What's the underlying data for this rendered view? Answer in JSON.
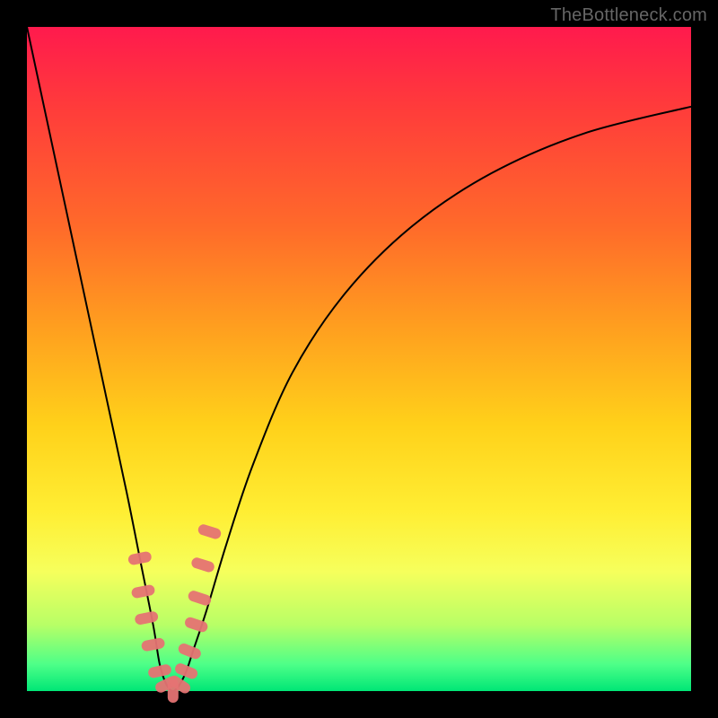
{
  "watermark": "TheBottleneck.com",
  "colors": {
    "frame": "#000000",
    "gradient_top": "#ff1a4d",
    "gradient_mid_upper": "#ff9e1f",
    "gradient_mid": "#ffee33",
    "gradient_lower": "#4dff88",
    "gradient_bottom": "#00e676",
    "curve": "#000000",
    "marker": "#e57373"
  },
  "chart_data": {
    "type": "line",
    "title": "",
    "xlabel": "",
    "ylabel": "",
    "xlim": [
      0,
      100
    ],
    "ylim": [
      0,
      100
    ],
    "x": [
      0,
      3,
      6,
      9,
      12,
      15,
      17,
      19,
      20,
      21,
      22,
      23,
      24,
      25,
      27,
      30,
      34,
      40,
      48,
      58,
      70,
      84,
      100
    ],
    "y": [
      100,
      86,
      72,
      58,
      44,
      30,
      20,
      10,
      4,
      1,
      0,
      1,
      3,
      6,
      12,
      22,
      34,
      48,
      60,
      70,
      78,
      84,
      88
    ],
    "markers": {
      "note": "salmon capsule-shaped markers clustered near the curve minimum",
      "points": [
        {
          "x": 17,
          "y": 20
        },
        {
          "x": 17.5,
          "y": 15
        },
        {
          "x": 18,
          "y": 11
        },
        {
          "x": 19,
          "y": 7
        },
        {
          "x": 20,
          "y": 3
        },
        {
          "x": 21,
          "y": 1
        },
        {
          "x": 22,
          "y": 0
        },
        {
          "x": 23,
          "y": 1
        },
        {
          "x": 24,
          "y": 3
        },
        {
          "x": 24.5,
          "y": 6
        },
        {
          "x": 25.5,
          "y": 10
        },
        {
          "x": 26,
          "y": 14
        },
        {
          "x": 26.5,
          "y": 19
        },
        {
          "x": 27.5,
          "y": 24
        }
      ]
    }
  }
}
